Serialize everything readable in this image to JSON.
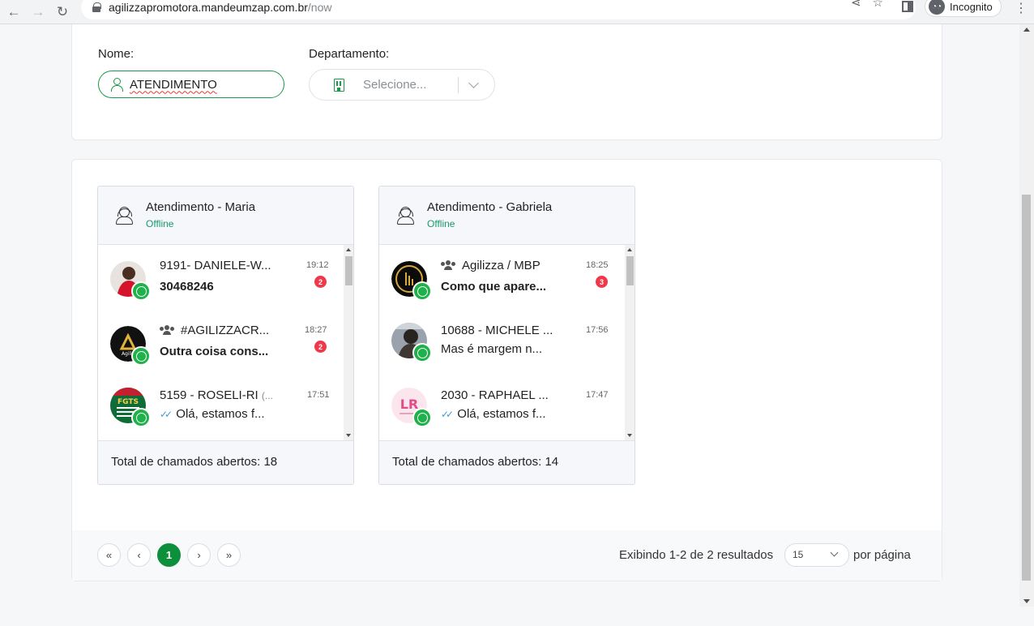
{
  "browser": {
    "url_host": "agilizzapromotora.mandeumzap.com.br",
    "url_path": "/now",
    "incognito_label": "Incognito"
  },
  "filters": {
    "name_label": "Nome:",
    "name_value": "ATENDIMENTO",
    "department_label": "Departamento:",
    "department_placeholder": "Selecione..."
  },
  "departments": [
    {
      "title": "Atendimento - Maria",
      "status": "Offline",
      "total": "Total de chamados abertos: 18",
      "conversations": [
        {
          "name": "9191- DANIELE-W...",
          "message": "30468246",
          "time": "19:12",
          "unread": "2"
        },
        {
          "name": "#AGILIZZACR...",
          "message": "Outra coisa cons...",
          "time": "18:27",
          "unread": "2"
        },
        {
          "name": "5159 - ROSELI-RI",
          "name_suffix": "(...",
          "message": "Olá, estamos f...",
          "time": "17:51"
        }
      ]
    },
    {
      "title": "Atendimento - Gabriela",
      "status": "Offline",
      "total": "Total de chamados abertos: 14",
      "conversations": [
        {
          "name": "Agilizza / MBP",
          "message": "Como que apare...",
          "time": "18:25",
          "unread": "3"
        },
        {
          "name": "10688 - MICHELE ...",
          "message": "Mas é margem n...",
          "time": "17:56"
        },
        {
          "name": "2030 - RAPHAEL ...",
          "message": "Olá, estamos f...",
          "time": "17:47"
        }
      ]
    }
  ],
  "avatars": {
    "agilizza_text": "Agiliz",
    "fgts_text": "FGTS",
    "lr_text": "LR"
  },
  "pagination": {
    "first": "«",
    "prev": "‹",
    "current": "1",
    "next": "›",
    "last": "»",
    "showing": "Exibindo 1-2 de 2 resultados",
    "per_page_value": "15",
    "per_page_label": "por página"
  },
  "colors": {
    "accent": "#1a9a4b",
    "whatsapp": "#1fb14a",
    "unread": "#f0384b",
    "status": "#1a9a6b"
  }
}
